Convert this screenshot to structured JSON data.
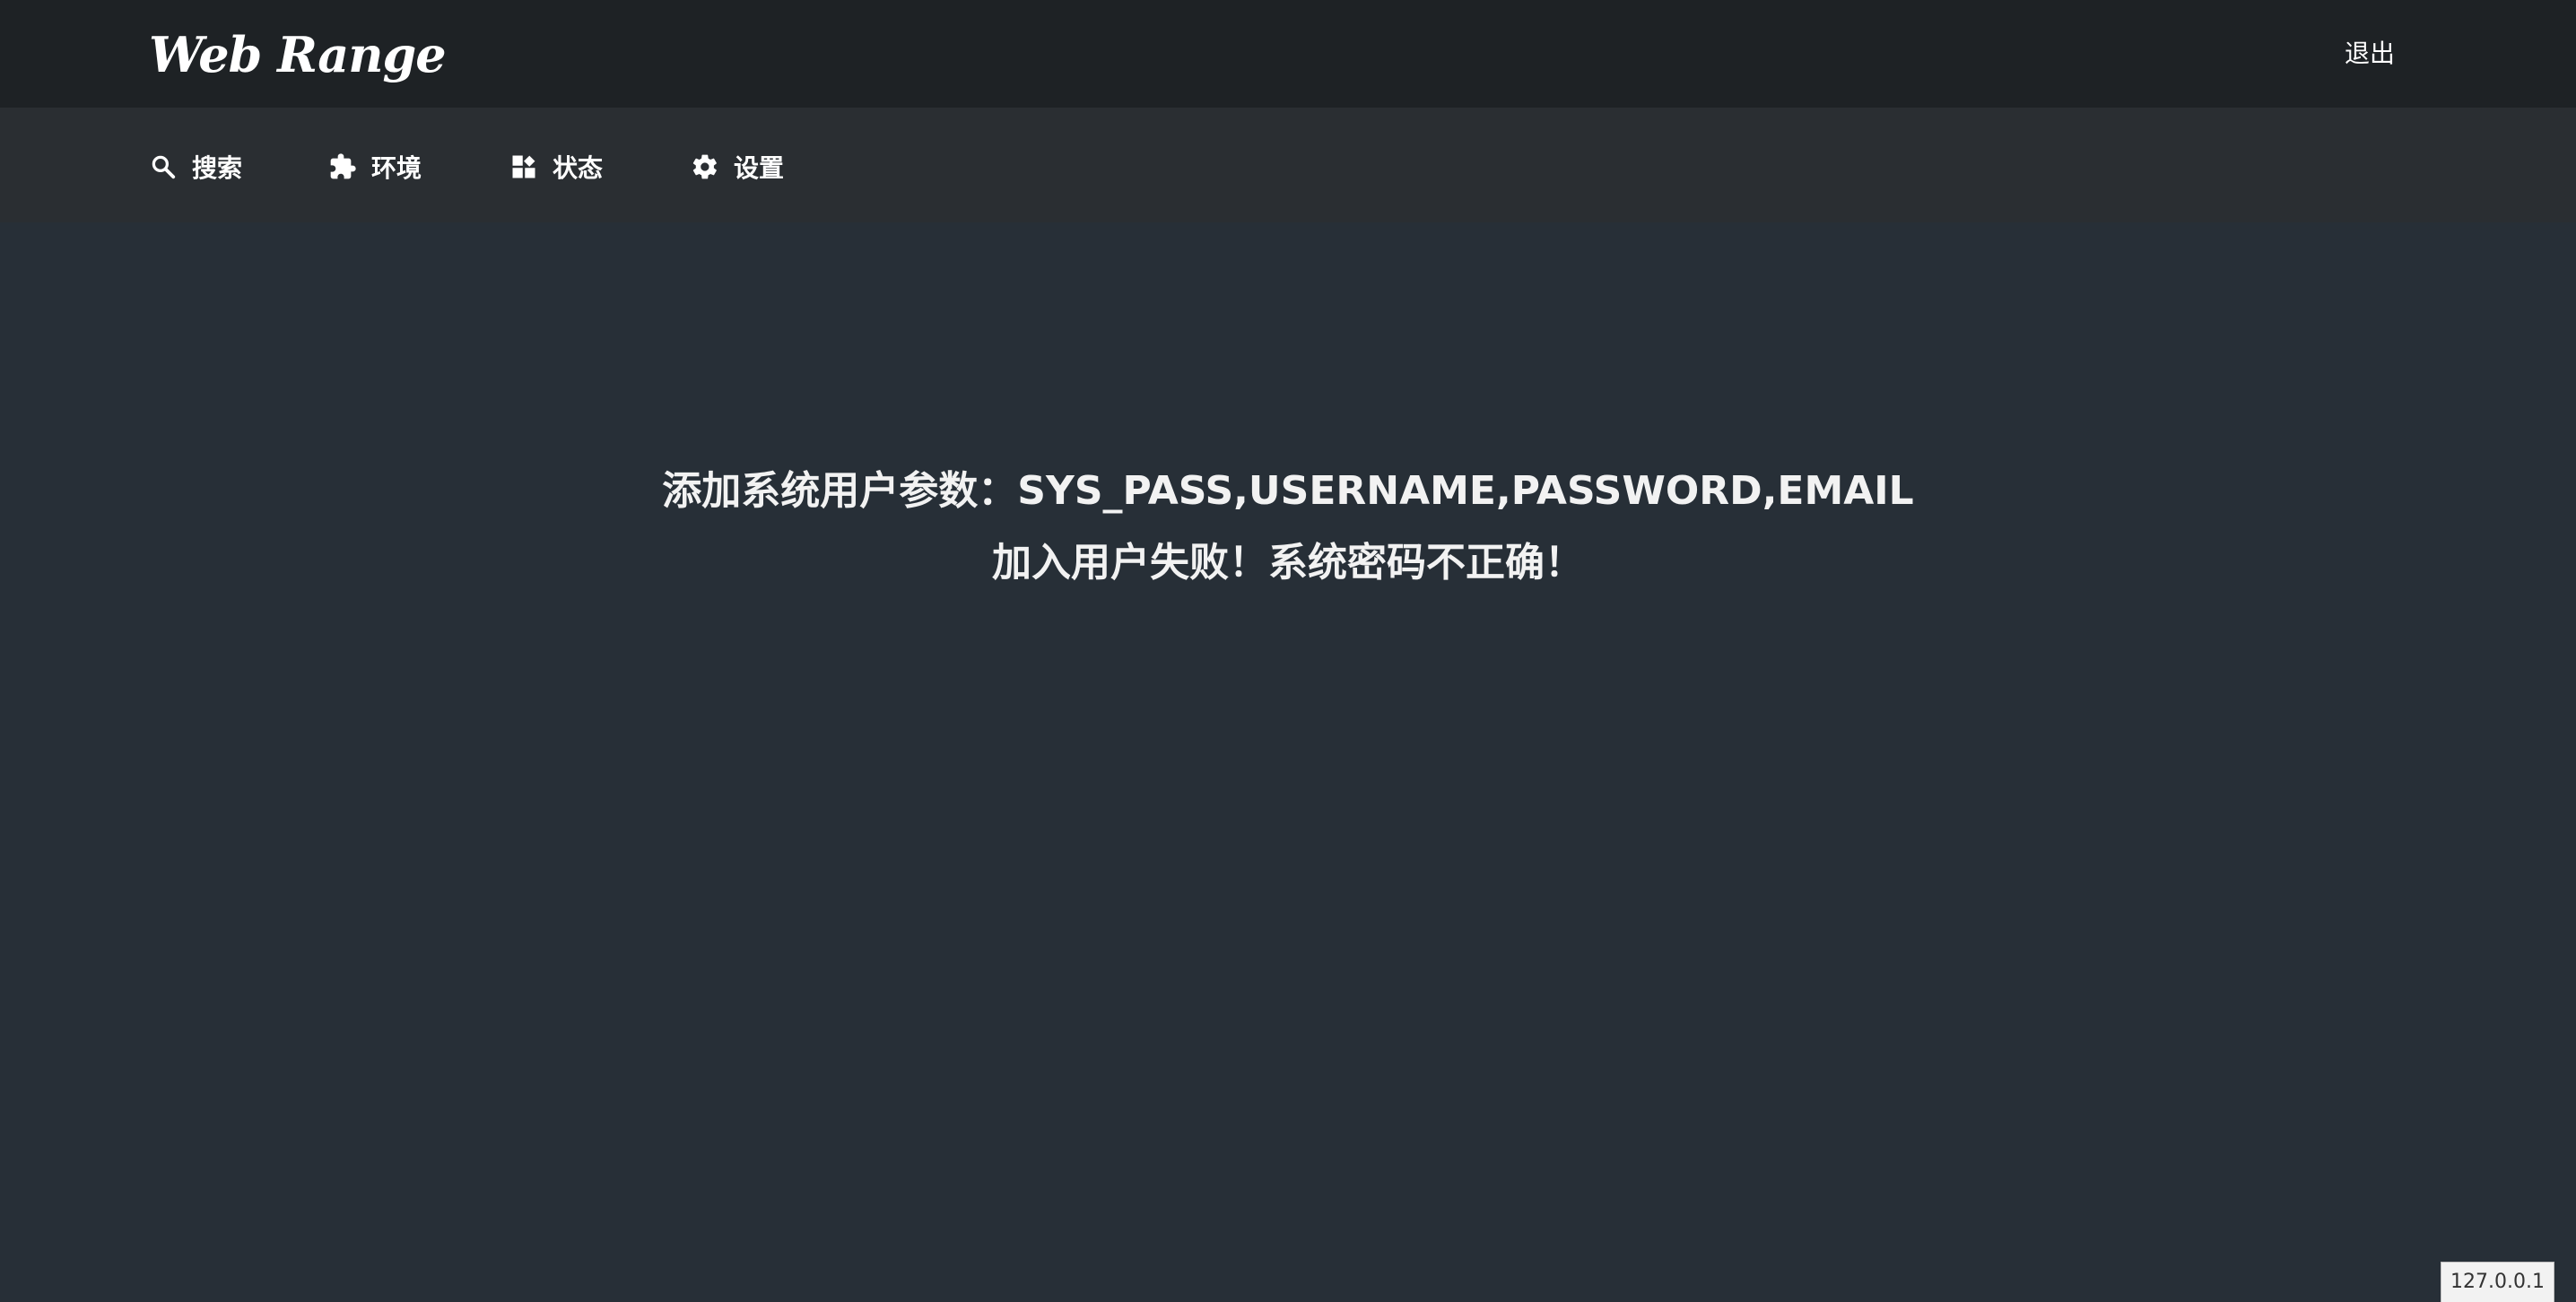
{
  "header": {
    "brand": "Web Range",
    "logout_label": "退出"
  },
  "nav": {
    "items": [
      {
        "label": "搜索",
        "icon": "search-icon"
      },
      {
        "label": "环境",
        "icon": "puzzle-icon"
      },
      {
        "label": "状态",
        "icon": "dashboard-icon"
      },
      {
        "label": "设置",
        "icon": "gear-icon"
      }
    ]
  },
  "main": {
    "line1": "添加系统用户参数：SYS_PASS,USERNAME,PASSWORD,EMAIL",
    "line2": "加入用户失败！系统密码不正确！"
  },
  "status": {
    "ip": "127.0.0.1"
  },
  "colors": {
    "topbar": "#1e2225",
    "navbar": "#2a2e32",
    "background": "#272f37",
    "text": "#ffffff"
  }
}
